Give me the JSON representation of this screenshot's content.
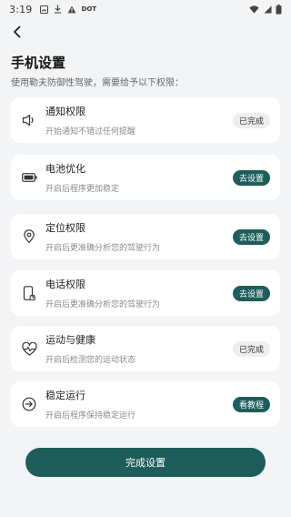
{
  "status_bar": {
    "time": "3:19",
    "dot_label": "DOT"
  },
  "page": {
    "title": "手机设置",
    "subtitle": "使用勒夫防御性驾驶，需要给予以下权限："
  },
  "permissions": [
    {
      "title": "通知权限",
      "desc": "开始通知不错过任何提醒",
      "button": "已完成",
      "state": "done",
      "icon": "speaker-icon"
    },
    {
      "title": "电池优化",
      "desc": "开启后程序更加稳定",
      "button": "去设置",
      "state": "action",
      "icon": "battery-icon"
    },
    {
      "title": "定位权限",
      "desc": "开启后更准确分析您的驾驶行为",
      "button": "去设置",
      "state": "action",
      "icon": "location-pin-icon"
    },
    {
      "title": "电话权限",
      "desc": "开启后更准确分析您的驾驶行为",
      "button": "去设置",
      "state": "action",
      "icon": "phone-icon"
    },
    {
      "title": "运动与健康",
      "desc": "开启后检测您的运动状态",
      "button": "已完成",
      "state": "done",
      "icon": "heart-pulse-icon"
    },
    {
      "title": "稳定运行",
      "desc": "开启后程序保持稳定运行",
      "button": "看教程",
      "state": "action",
      "icon": "arrow-circle-icon"
    }
  ],
  "finish_button": "完成设置",
  "colors": {
    "accent": "#1d5e5b",
    "background": "#f3f4f5",
    "card": "#ffffff",
    "done_pill": "#eeeeee"
  }
}
